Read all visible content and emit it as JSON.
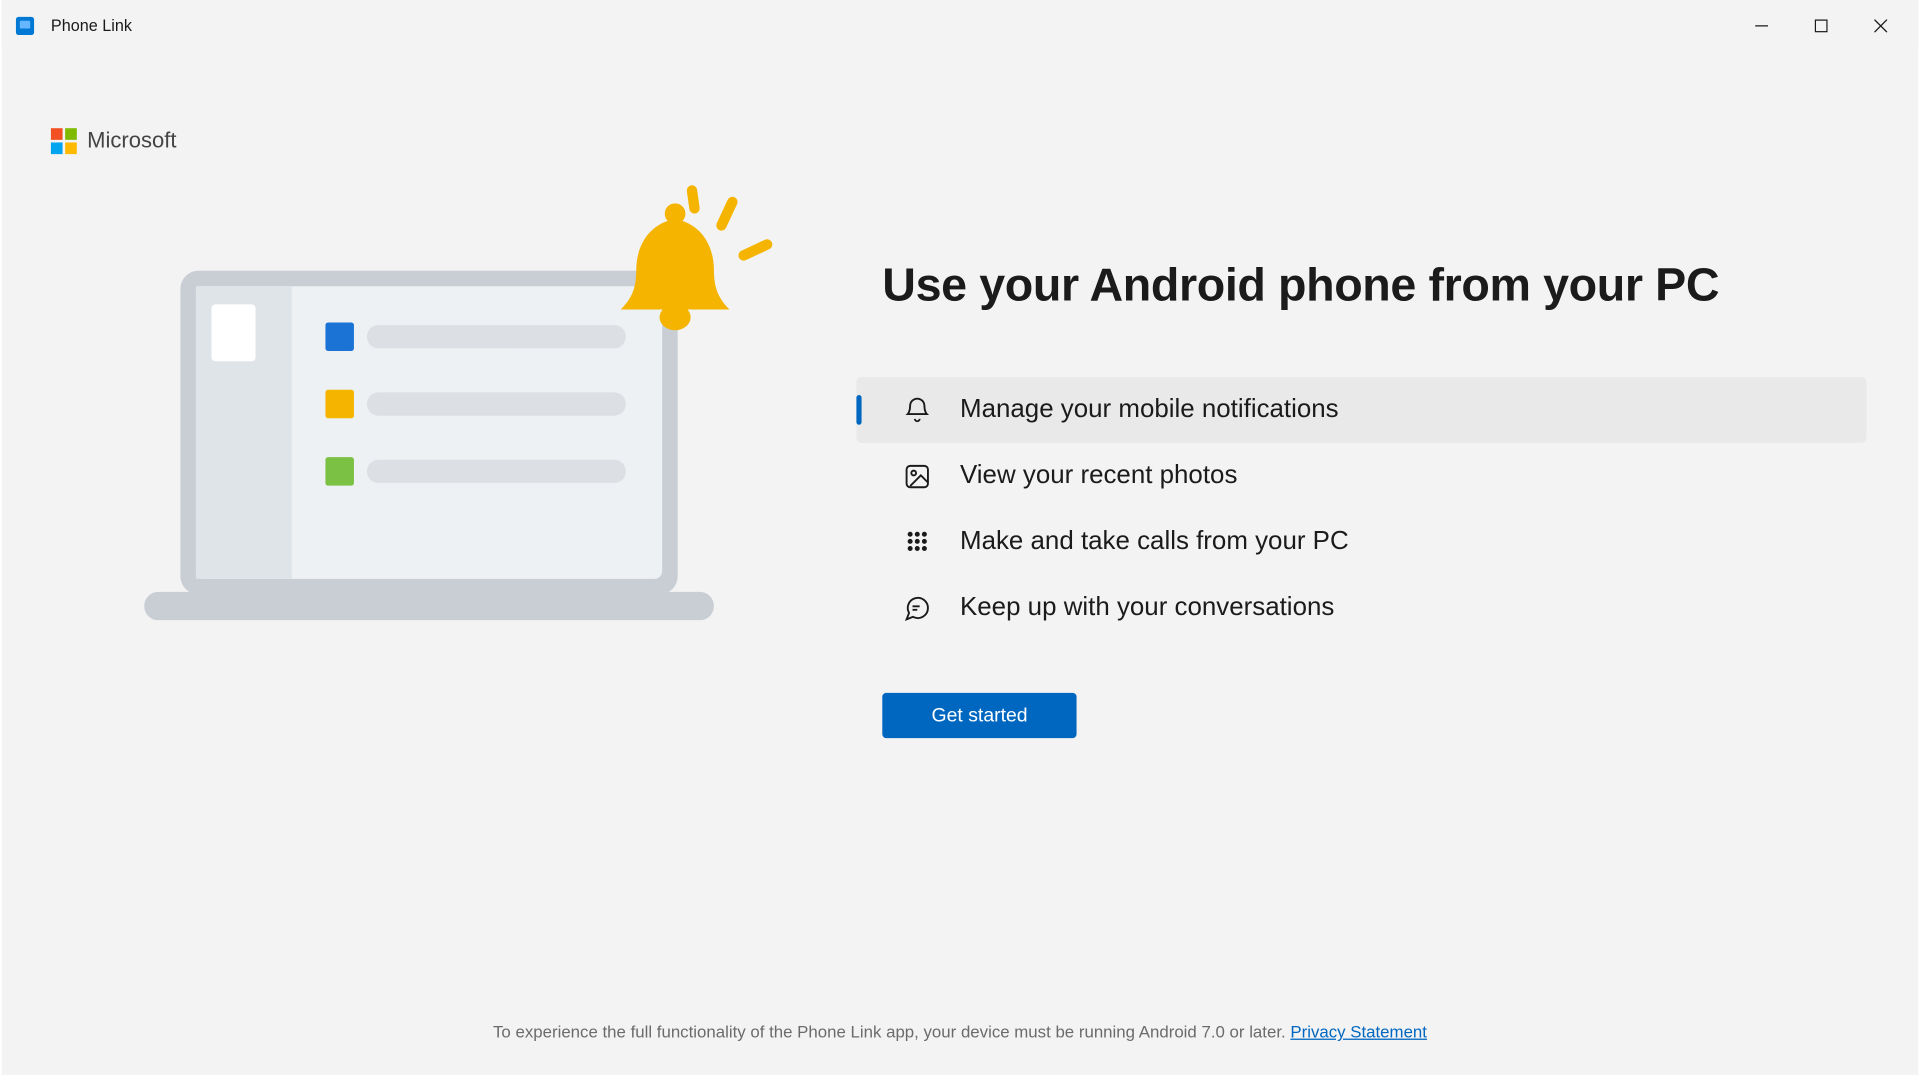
{
  "titlebar": {
    "app_name": "Phone Link"
  },
  "brand": {
    "name": "Microsoft"
  },
  "main": {
    "headline": "Use your Android phone from your PC",
    "features": [
      {
        "icon": "bell-icon",
        "label": "Manage your mobile notifications",
        "active": true
      },
      {
        "icon": "photo-icon",
        "label": "View your recent photos",
        "active": false
      },
      {
        "icon": "dialpad-icon",
        "label": "Make and take calls from your PC",
        "active": false
      },
      {
        "icon": "chat-icon",
        "label": "Keep up with your conversations",
        "active": false
      }
    ],
    "cta_label": "Get started"
  },
  "footer": {
    "text": "To experience the full functionality of the Phone Link app, your device must be running Android 7.0 or later. ",
    "link_label": "Privacy Statement"
  }
}
